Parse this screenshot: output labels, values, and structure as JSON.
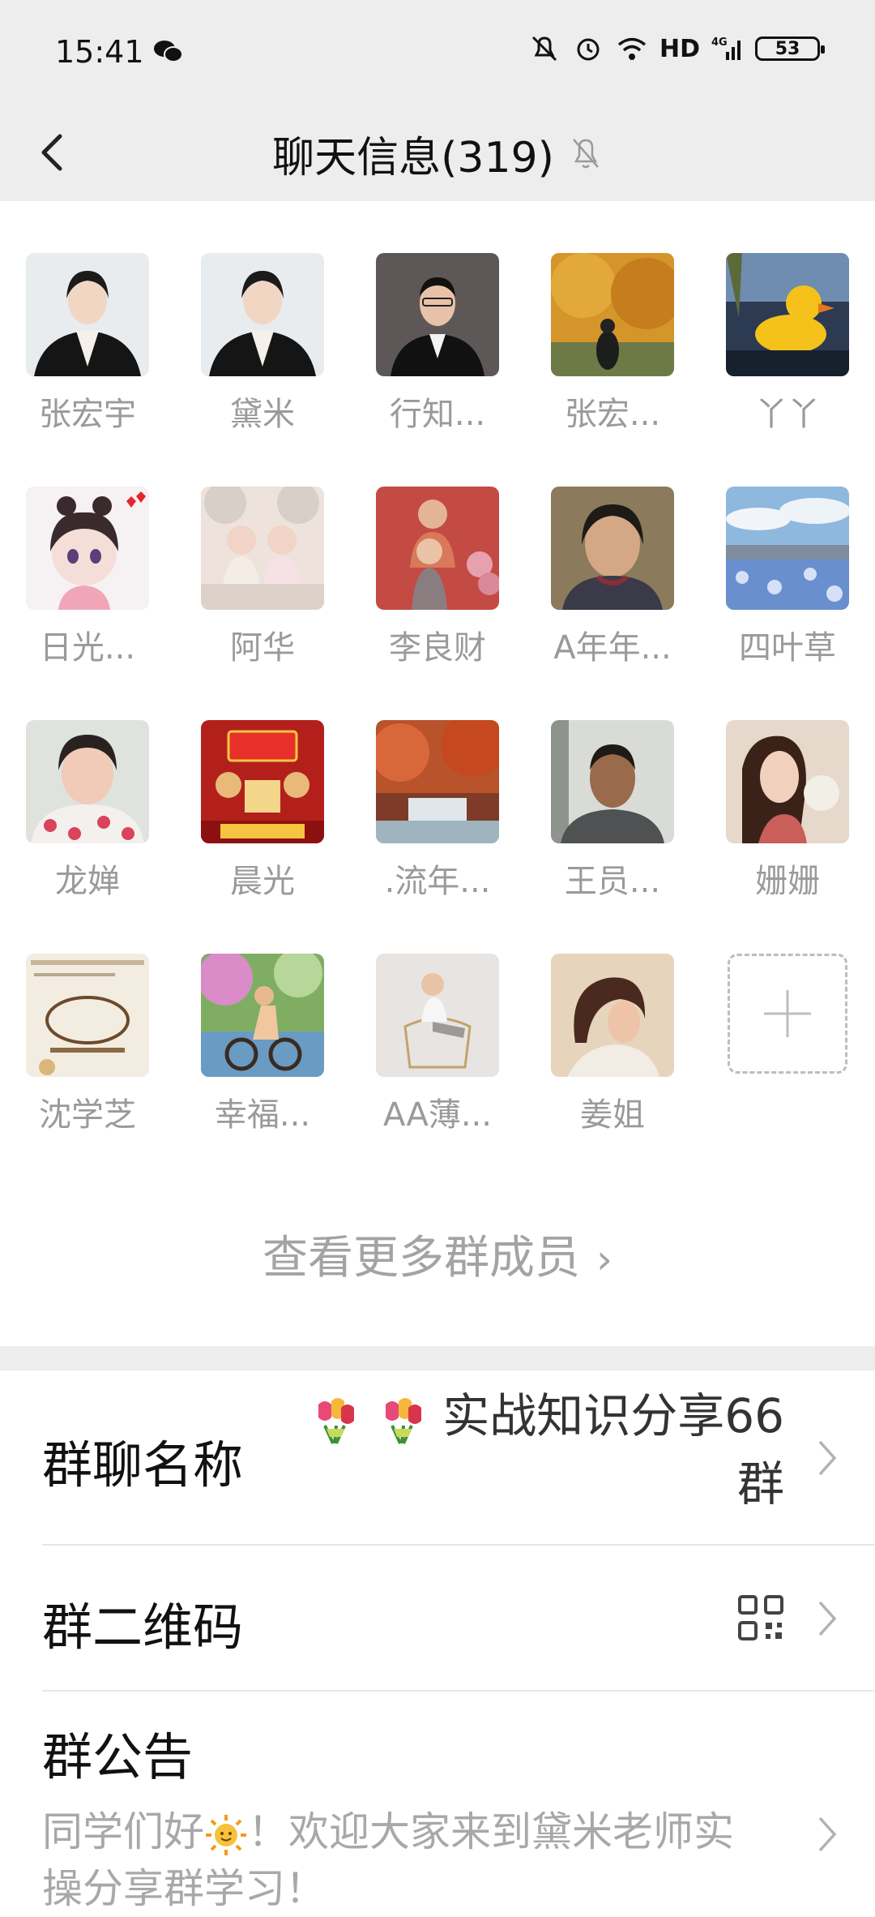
{
  "status_bar": {
    "time": "15:41",
    "network": "HD",
    "signal_label": "4G",
    "battery": "53"
  },
  "header": {
    "title": "聊天信息(319)"
  },
  "members": [
    {
      "name": "张宏宇",
      "avatar_color": "#e9ecef"
    },
    {
      "name": "黛米",
      "avatar_color": "#e9ecef"
    },
    {
      "name": "行知...",
      "avatar_color": "#5e5758"
    },
    {
      "name": "张宏...",
      "avatar_color": "#c98a2a"
    },
    {
      "name": "丫丫",
      "avatar_color": "#2c3a52"
    },
    {
      "name": "日光...",
      "avatar_color": "#f6f1f2"
    },
    {
      "name": "阿华",
      "avatar_color": "#ede3dc"
    },
    {
      "name": "李良财",
      "avatar_color": "#c44a44"
    },
    {
      "name": "A年年...",
      "avatar_color": "#8c7a5c"
    },
    {
      "name": "四叶草",
      "avatar_color": "#8fb8df"
    },
    {
      "name": "龙婵",
      "avatar_color": "#dfe3de"
    },
    {
      "name": "晨光",
      "avatar_color": "#b3201c"
    },
    {
      "name": ".流年...",
      "avatar_color": "#b8532c"
    },
    {
      "name": "王员...",
      "avatar_color": "#6b6a5f"
    },
    {
      "name": "姗姗",
      "avatar_color": "#e7d8cc"
    },
    {
      "name": "沈学芝",
      "avatar_color": "#f3ede1"
    },
    {
      "name": "幸福...",
      "avatar_color": "#7fae63"
    },
    {
      "name": "AA薄...",
      "avatar_color": "#e7e4e2"
    },
    {
      "name": "姜姐",
      "avatar_color": "#e6d4bd"
    }
  ],
  "more_members": "查看更多群成员",
  "group_name": {
    "label": "群聊名称",
    "value_line1": "实战知识分享66",
    "value_line2": "群"
  },
  "group_qr": {
    "label": "群二维码"
  },
  "group_notice": {
    "label": "群公告",
    "text_part1": "同学们好",
    "text_part2": "！欢迎大家来到黛米老师实",
    "text_line2": "操分享群学习！"
  },
  "colors": {
    "background": "#ededed",
    "text_primary": "#111111",
    "text_secondary": "#9a9a9a"
  },
  "icons": [
    "back-icon",
    "mute-icon",
    "wechat-icon",
    "chevron-right-icon",
    "qr-code-icon",
    "add-member-icon"
  ]
}
